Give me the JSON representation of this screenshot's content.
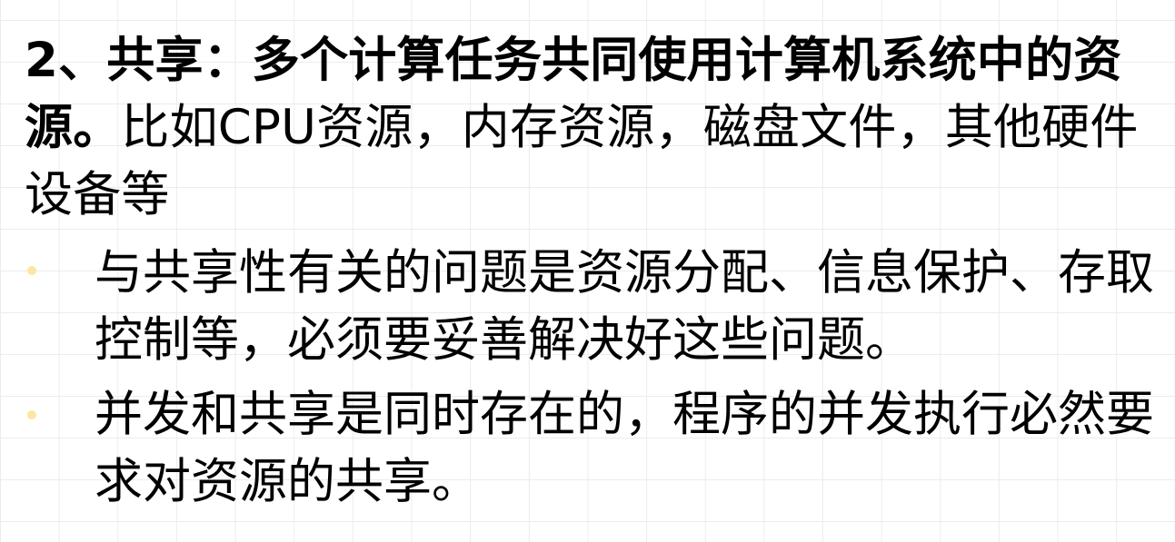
{
  "heading": {
    "bold_text": "2、共享：多个计算任务共同使用计算机系统中的资源。",
    "normal_text": "比如CPU资源，内存资源，磁盘文件，其他硬件设备等"
  },
  "bullets": [
    {
      "text": "与共享性有关的问题是资源分配、信息保护、存取控制等，必须要妥善解决好这些问题。"
    },
    {
      "text": "并发和共享是同时存在的，程序的并发执行必然要求对资源的共享。"
    }
  ],
  "colors": {
    "bullet_dot": "#fbe7a1",
    "grid_line": "#ececec",
    "text": "#000000"
  }
}
